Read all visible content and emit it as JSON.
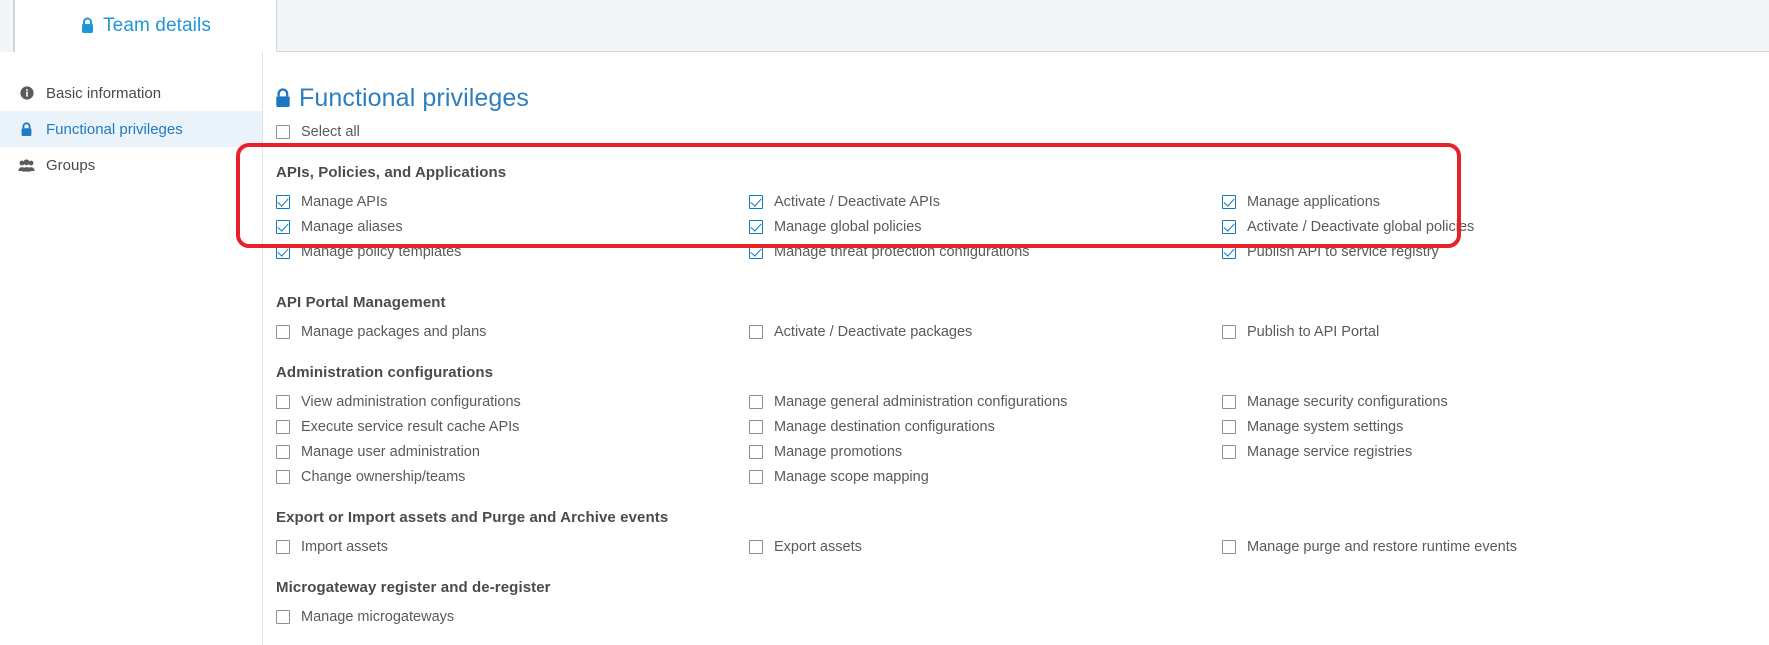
{
  "tabs": {
    "active": {
      "label": "Team details",
      "icon": "lock-icon"
    }
  },
  "sidebar": {
    "items": [
      {
        "label": "Basic information",
        "icon": "info-circle-icon",
        "active": false
      },
      {
        "label": "Functional privileges",
        "icon": "lock-icon",
        "active": true
      },
      {
        "label": "Groups",
        "icon": "users-group-icon",
        "active": false
      }
    ]
  },
  "main": {
    "title": "Functional privileges",
    "title_icon": "lock-icon",
    "select_all": {
      "label": "Select all",
      "checked": false
    },
    "groups": [
      {
        "title": "APIs, Policies, and Applications",
        "highlighted": true,
        "columns": [
          [
            {
              "label": "Manage APIs",
              "checked": true
            },
            {
              "label": "Manage aliases",
              "checked": true
            },
            {
              "label": "Manage policy templates",
              "checked": true
            }
          ],
          [
            {
              "label": "Activate / Deactivate APIs",
              "checked": true
            },
            {
              "label": "Manage global policies",
              "checked": true
            },
            {
              "label": "Manage threat protection configurations",
              "checked": true
            }
          ],
          [
            {
              "label": "Manage applications",
              "checked": true
            },
            {
              "label": "Activate / Deactivate global policies",
              "checked": true
            },
            {
              "label": "Publish API to service registry",
              "checked": true
            }
          ]
        ]
      },
      {
        "title": "API Portal Management",
        "highlighted": false,
        "columns": [
          [
            {
              "label": "Manage packages and plans",
              "checked": false
            }
          ],
          [
            {
              "label": "Activate / Deactivate packages",
              "checked": false
            }
          ],
          [
            {
              "label": "Publish to API Portal",
              "checked": false
            }
          ]
        ]
      },
      {
        "title": "Administration configurations",
        "highlighted": false,
        "columns": [
          [
            {
              "label": "View administration configurations",
              "checked": false
            },
            {
              "label": "Execute service result cache APIs",
              "checked": false
            },
            {
              "label": "Manage user administration",
              "checked": false
            },
            {
              "label": "Change ownership/teams",
              "checked": false
            }
          ],
          [
            {
              "label": "Manage general administration configurations",
              "checked": false
            },
            {
              "label": "Manage destination configurations",
              "checked": false
            },
            {
              "label": "Manage promotions",
              "checked": false
            },
            {
              "label": "Manage scope mapping",
              "checked": false
            }
          ],
          [
            {
              "label": "Manage security configurations",
              "checked": false
            },
            {
              "label": "Manage system settings",
              "checked": false
            },
            {
              "label": "Manage service registries",
              "checked": false
            }
          ]
        ]
      },
      {
        "title": "Export or Import assets and Purge and Archive events",
        "highlighted": false,
        "columns": [
          [
            {
              "label": "Import assets",
              "checked": false
            }
          ],
          [
            {
              "label": "Export assets",
              "checked": false
            }
          ],
          [
            {
              "label": "Manage purge and restore runtime events",
              "checked": false
            }
          ]
        ]
      },
      {
        "title": "Microgateway register and de-register",
        "highlighted": false,
        "columns": [
          [
            {
              "label": "Manage microgateways",
              "checked": false
            }
          ],
          [],
          []
        ]
      }
    ]
  },
  "annotation": {
    "type": "red-rounded-rectangle",
    "color": "#e8202a",
    "targets_group": "APIs, Policies, and Applications"
  }
}
